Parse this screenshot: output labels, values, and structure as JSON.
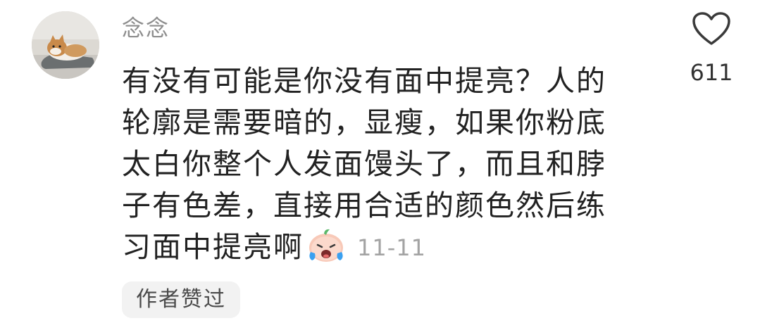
{
  "comment": {
    "username": "念念",
    "lines": [
      "有没有可能是你没有面中提亮？人的",
      "轮廓是需要暗的，显瘦，如果你粉底",
      "太白你整个人发面馒头了，而且和脖",
      "子有色差，直接用合适的颜色然后练",
      "习面中提亮啊"
    ],
    "emoji": "crying-laughing-emoji",
    "timestamp": "11-11",
    "badge": "作者赞过"
  },
  "like": {
    "icon": "heart-icon",
    "count": "611"
  },
  "avatar": {
    "icon": "shiba-dog-avatar"
  }
}
